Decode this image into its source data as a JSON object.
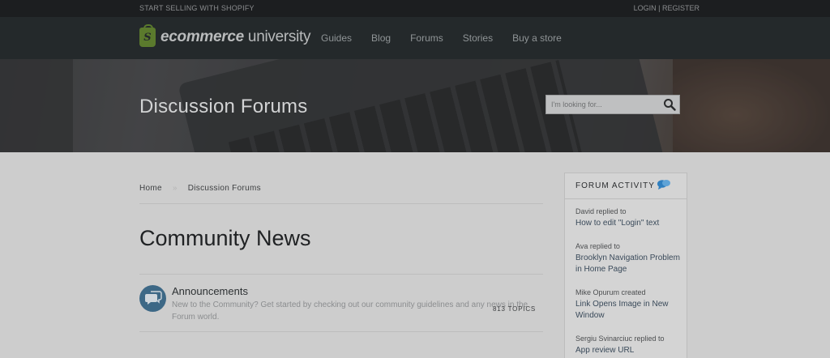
{
  "topbar": {
    "left_text": "START SELLING WITH SHOPIFY",
    "login": "LOGIN",
    "divider": "|",
    "register": "REGISTER"
  },
  "logo": {
    "bag_letter": "S",
    "part1": "ecommerce",
    "part2": "university"
  },
  "nav": {
    "items": [
      "Guides",
      "Blog",
      "Forums",
      "Stories",
      "Buy a store"
    ]
  },
  "hero": {
    "title": "Discussion Forums",
    "search_placeholder": "I'm looking for..."
  },
  "breadcrumb": {
    "home": "Home",
    "separator": "»",
    "current": "Discussion Forums"
  },
  "main": {
    "page_title": "Community News",
    "topics": [
      {
        "title": "Announcements",
        "description": "New to the Community? Get started by checking out our community guidelines and any news in the Forum world.",
        "count": "813 TOPICS"
      }
    ]
  },
  "sidebar": {
    "heading": "FORUM ACTIVITY",
    "activity": [
      {
        "who": "David replied to",
        "what": "How to edit \"Login\" text"
      },
      {
        "who": "Ava replied to",
        "what": "Brooklyn Navigation Problem in Home Page"
      },
      {
        "who": "Mike Opurum created",
        "what": "Link Opens Image in New Window"
      },
      {
        "who": "Sergiu Svinarciuc replied to",
        "what": "App review URL"
      }
    ]
  },
  "colors": {
    "nav_bg": "#24292b",
    "topbar_bg": "#1c1e20",
    "logo_green": "#5b7a2d",
    "topic_icon": "#3d6886",
    "activity_icon": "#2f7fbf"
  }
}
